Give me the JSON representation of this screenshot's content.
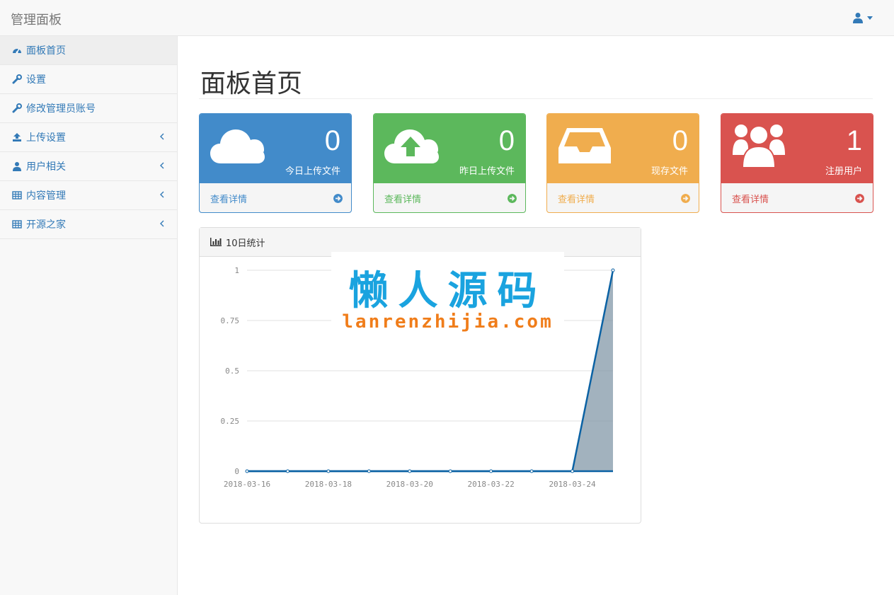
{
  "brand": "管理面板",
  "sidebar": {
    "items": [
      {
        "label": "面板首页",
        "icon": "dashboard-icon"
      },
      {
        "label": "设置",
        "icon": "wrench-icon"
      },
      {
        "label": "修改管理员账号",
        "icon": "wrench-icon"
      },
      {
        "label": "上传设置",
        "icon": "upload-icon"
      },
      {
        "label": "用户相关",
        "icon": "user-icon"
      },
      {
        "label": "内容管理",
        "icon": "table-icon"
      },
      {
        "label": "开源之家",
        "icon": "table-icon"
      }
    ]
  },
  "page_title": "面板首页",
  "stats": [
    {
      "value": "0",
      "label": "今日上传文件",
      "more": "查看详情",
      "color": "#428bca",
      "icon": "cloud-icon"
    },
    {
      "value": "0",
      "label": "昨日上传文件",
      "more": "查看详情",
      "color": "#5cb85c",
      "icon": "cloud-upload-icon"
    },
    {
      "value": "0",
      "label": "现存文件",
      "more": "查看详情",
      "color": "#f0ad4e",
      "icon": "inbox-icon"
    },
    {
      "value": "1",
      "label": "注册用户",
      "more": "查看详情",
      "color": "#d9534f",
      "icon": "users-icon"
    }
  ],
  "chart_panel": {
    "title": "10日统计"
  },
  "watermark": {
    "cn": "懒人源码",
    "en": "lanrenzhijia.com"
  },
  "chart_data": {
    "type": "area",
    "x": [
      "2018-03-16",
      "2018-03-17",
      "2018-03-18",
      "2018-03-19",
      "2018-03-20",
      "2018-03-21",
      "2018-03-22",
      "2018-03-23",
      "2018-03-24",
      "2018-03-25"
    ],
    "series": [
      {
        "values": [
          0,
          0,
          0,
          0,
          0,
          0,
          0,
          0,
          0,
          1
        ]
      }
    ],
    "x_tick_labels": [
      "2018-03-16",
      "2018-03-18",
      "2018-03-20",
      "2018-03-22",
      "2018-03-24"
    ],
    "y_tick_labels": [
      "0",
      "0.25",
      "0.5",
      "0.75",
      "1"
    ],
    "ylim": [
      0,
      1
    ],
    "grid": true,
    "line_color": "#0b62a4",
    "fill_color": "#7a92a3"
  }
}
